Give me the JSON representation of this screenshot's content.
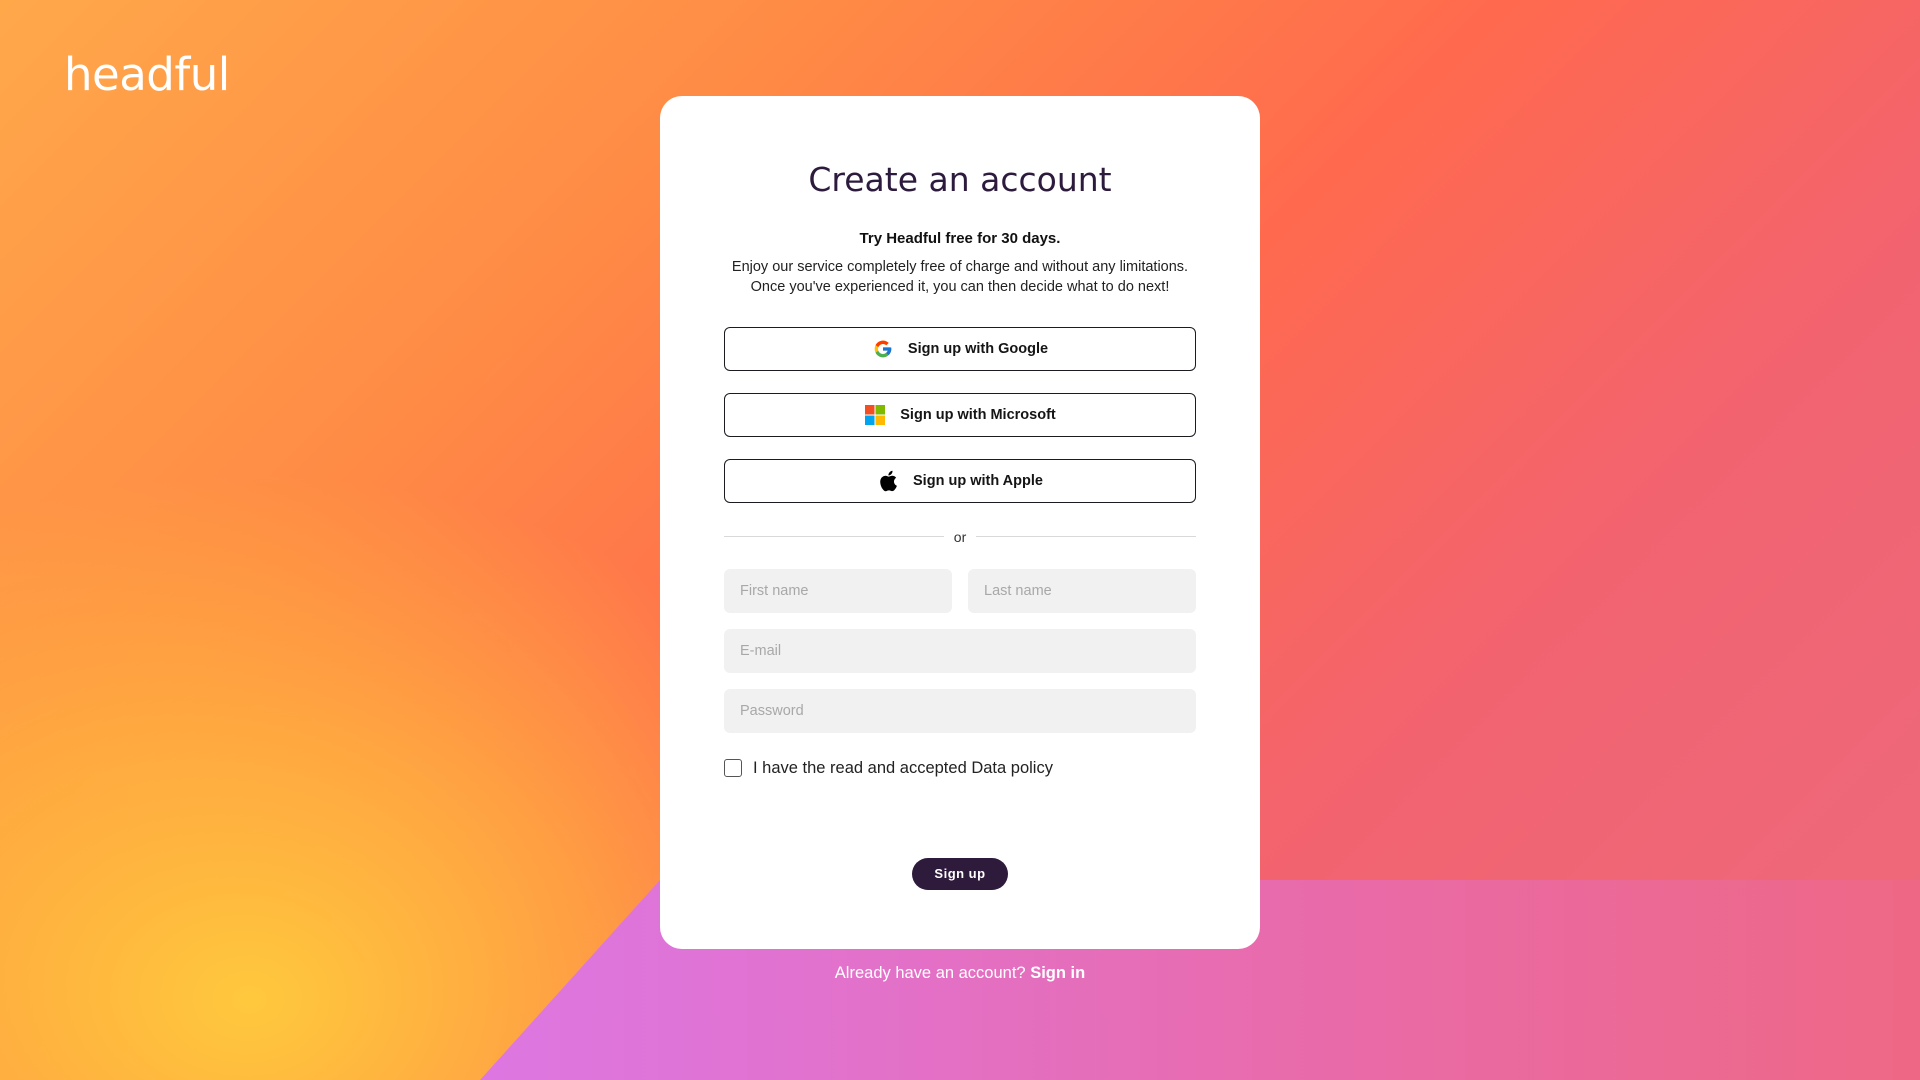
{
  "brand": {
    "logo_text": "headful"
  },
  "card": {
    "title": "Create an account",
    "subtitle": "Try Headful free for 30 days.",
    "description_line1": "Enjoy our service completely free of charge and without any limitations.",
    "description_line2": "Once you've experienced it, you can then decide what to do next!"
  },
  "social": {
    "google": {
      "label": "Sign up with Google",
      "icon": "google-icon"
    },
    "microsoft": {
      "label": "Sign up with Microsoft",
      "icon": "microsoft-icon"
    },
    "apple": {
      "label": "Sign up with Apple",
      "icon": "apple-icon"
    }
  },
  "divider": {
    "text": "or"
  },
  "form": {
    "first_name_placeholder": "First name",
    "last_name_placeholder": "Last name",
    "email_placeholder": "E-mail",
    "password_placeholder": "Password",
    "policy_label": "I have the read and accepted Data policy",
    "policy_checked": false,
    "submit_label": "Sign up"
  },
  "footer": {
    "prompt": "Already have an account?",
    "link": "Sign in"
  },
  "colors": {
    "accent_dark": "#2e1a3b",
    "title": "#2d1b3d",
    "field_bg": "#f1f1f1",
    "bg_orange": "#ff8a45",
    "bg_coral": "#ff6a4e",
    "bg_pink": "#ec6a7e",
    "bg_yellow": "#ffcd3c",
    "bg_purple": "#d67cf5"
  }
}
